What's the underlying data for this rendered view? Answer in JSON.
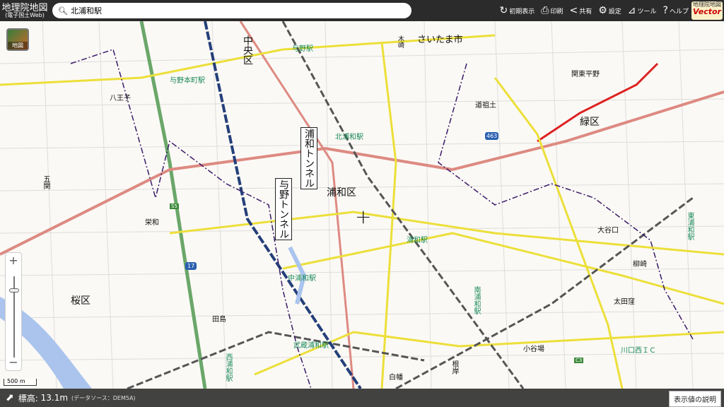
{
  "header": {
    "logo_title": "地理院地図",
    "logo_sub": "(電子国土Web)",
    "search_value": "北浦和駅",
    "menu": [
      {
        "icon": "reload-icon",
        "label": "初期表示"
      },
      {
        "icon": "print-icon",
        "label": "印刷"
      },
      {
        "icon": "share-icon",
        "label": "共有"
      },
      {
        "icon": "gear-icon",
        "label": "設定"
      },
      {
        "icon": "tool-icon",
        "label": "ツール"
      },
      {
        "icon": "help-icon",
        "label": "ヘルプ"
      }
    ],
    "vector_a": "地理院地図",
    "vector_b": "Vector"
  },
  "layer_button": "地図",
  "zoom": {
    "plus": "+",
    "minus": "−"
  },
  "scale": "500 m",
  "map_labels": {
    "saitama": "さいたま市",
    "chuo": "中央区",
    "yono": "与野駅",
    "yonohonmachi": "与野本町駅",
    "hachioji": "八王子",
    "kita_urawa": "北浦和駅",
    "urawa_ku": "浦和区",
    "urawa_tunnel": "浦和トンネル",
    "yono_tunnel": "与野トンネル",
    "urawa": "浦和駅",
    "minami_urawa": "南浦和駅",
    "naka_urawa": "中浦和駅",
    "musashi_urawa": "武蔵浦和駅",
    "nishi_urawa": "西浦和駅",
    "sakura_ku": "桜区",
    "midori_ku": "緑区",
    "kanto": "関東平野",
    "dosojin": "道祖土",
    "oyaguchi": "大谷口",
    "yanagisaki": "柳崎",
    "ota": "太田窪",
    "koyaba": "小谷場",
    "kawaguchi_ic": "川口西ＩＣ",
    "shirahata": "白幡",
    "negishi": "根岸",
    "tajima": "田島",
    "sakaewa": "栄和",
    "goseki": "五関",
    "higashi_urawa": "東浦和駅",
    "route17": "17",
    "route463": "463",
    "s5": "S5",
    "c3": "C3",
    "ki": "木崎"
  },
  "footer": {
    "elevation_label": "標高:",
    "elevation": "13.1m",
    "source": "(データソース：DEM5A)",
    "explain_button": "表示値の説明"
  }
}
